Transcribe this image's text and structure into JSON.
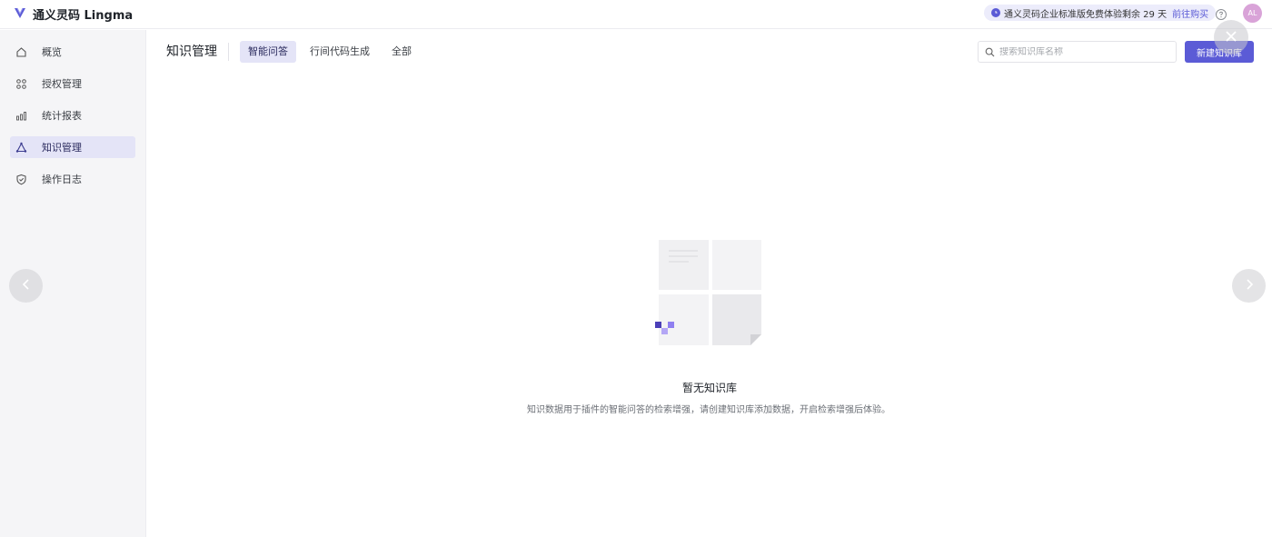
{
  "app": {
    "name": "通义灵码 Lingma"
  },
  "topbar": {
    "trial_text": "通义灵码企业标准版免费体验剩余 29 天",
    "trial_link": "前往购买",
    "avatar_initials": "AL"
  },
  "sidebar": {
    "items": [
      {
        "label": "概览",
        "icon": "home-icon"
      },
      {
        "label": "授权管理",
        "icon": "grid-icon"
      },
      {
        "label": "统计报表",
        "icon": "bar-chart-icon"
      },
      {
        "label": "知识管理",
        "icon": "triangle-nodes-icon",
        "active": true
      },
      {
        "label": "操作日志",
        "icon": "shield-check-icon"
      }
    ]
  },
  "header": {
    "title": "知识管理",
    "tabs": [
      {
        "label": "智能问答",
        "active": true
      },
      {
        "label": "行间代码生成"
      },
      {
        "label": "全部"
      }
    ]
  },
  "search": {
    "placeholder": "搜索知识库名称",
    "value": ""
  },
  "create_button": "新建知识库",
  "empty_state": {
    "title": "暂无知识库",
    "description": "知识数据用于插件的智能问答的检索增强，请创建知识库添加数据，开启检索增强后体验。"
  },
  "colors": {
    "accent": "#5b5bd6",
    "active_bg": "#e4e4f7",
    "sidebar_bg": "#f5f5f7"
  }
}
